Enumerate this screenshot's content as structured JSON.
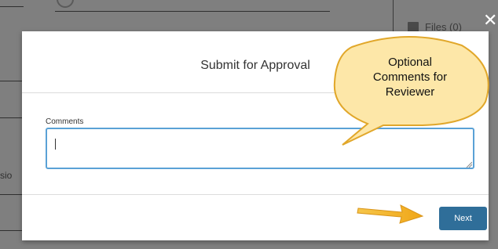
{
  "background": {
    "files_label": "Files (0)",
    "fragment_text": "sio"
  },
  "modal": {
    "title": "Submit for Approval",
    "comments_label": "Comments",
    "comments_value": "",
    "next_label": "Next"
  },
  "callout": {
    "line1": "Optional",
    "line2": "Comments for",
    "line3": "Reviewer"
  },
  "colors": {
    "accent": "#2f6e99",
    "input_focus": "#5aa1d6",
    "callout_fill": "#fde7a8",
    "callout_border": "#e1a72a",
    "arrow": "#f3b124"
  }
}
